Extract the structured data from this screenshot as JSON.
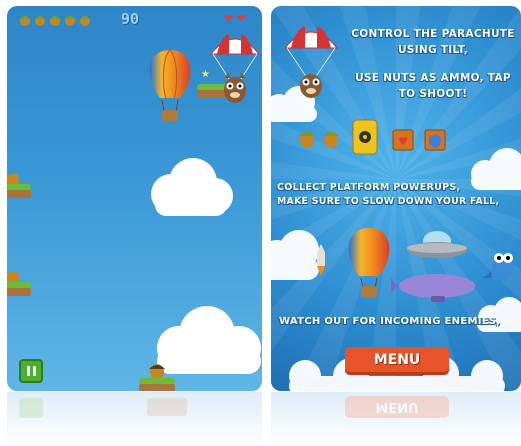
{
  "left_screen": {
    "nuts_count": 5,
    "score": "90",
    "lives": 2,
    "pause_icon": "pause-icon"
  },
  "right_screen": {
    "instruction_1_line1": "CONTROL THE PARACHUTE",
    "instruction_1_line2": "USING TILT,",
    "instruction_2_line1": "USE NUTS AS AMMO, TAP",
    "instruction_2_line2": "TO SHOOT!",
    "instruction_3_line1": "COLLECT PLATFORM POWERUPS,",
    "instruction_3_line2": "MAKE SURE TO SLOW DOWN YOUR FALL,",
    "instruction_4": "WATCH OUT FOR INCOMING ENEMIES,",
    "menu_button": "MENU",
    "reflection_text": "MENU"
  },
  "colors": {
    "sky_top": "#2e86c8",
    "menu_button": "#e8542a",
    "pause_button": "#4caf30"
  }
}
